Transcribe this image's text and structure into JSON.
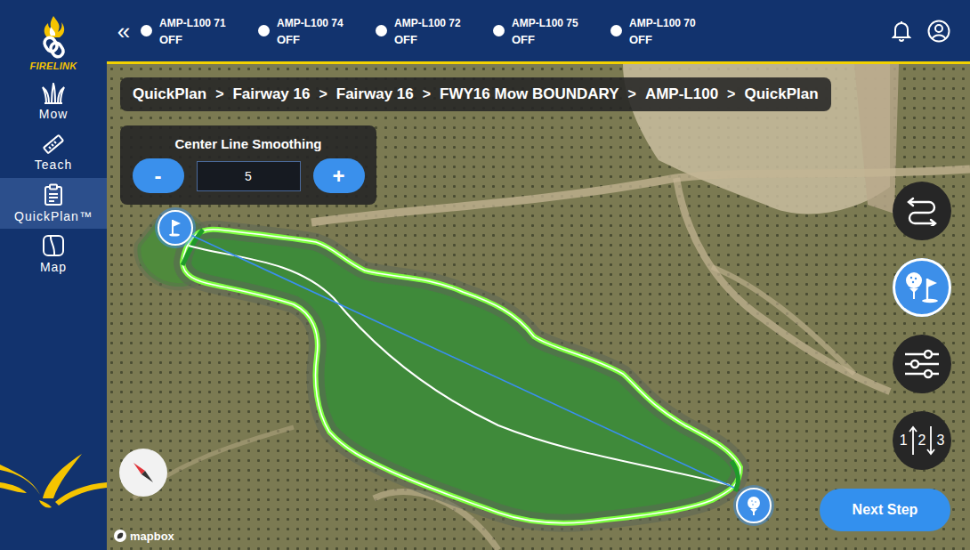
{
  "brand": {
    "name": "FIRELINK"
  },
  "sidebar": {
    "items": [
      {
        "label": "Mow",
        "selected": false,
        "kind": "mow"
      },
      {
        "label": "Teach",
        "selected": false,
        "kind": "teach"
      },
      {
        "label": "QuickPlan™",
        "selected": true,
        "kind": "plan"
      },
      {
        "label": "Map",
        "selected": false,
        "kind": "map"
      }
    ]
  },
  "topbar": {
    "collapse": "«",
    "devices": [
      {
        "name": "AMP-L100 71",
        "status": "OFF",
        "on": false
      },
      {
        "name": "AMP-L100 74",
        "status": "OFF",
        "on": false
      },
      {
        "name": "AMP-L100 72",
        "status": "OFF",
        "on": false
      },
      {
        "name": "AMP-L100 75",
        "status": "OFF",
        "on": false
      },
      {
        "name": "AMP-L100 70",
        "status": "OFF",
        "on": false
      }
    ]
  },
  "breadcrumb": {
    "separator": ">",
    "items": [
      "QuickPlan",
      "Fairway 16",
      "Fairway 16",
      "FWY16 Mow BOUNDARY",
      "AMP-L100",
      "QuickPlan"
    ]
  },
  "smoothing": {
    "label": "Center Line Smoothing",
    "value": "5",
    "decrement": "-",
    "increment": "+"
  },
  "tools": [
    {
      "kind": "route",
      "selected": false
    },
    {
      "kind": "teeflag",
      "selected": true
    },
    {
      "kind": "sliders",
      "selected": false
    },
    {
      "kind": "order",
      "selected": false,
      "labels": [
        "1",
        "2",
        "3"
      ]
    }
  ],
  "next_button": "Next Step",
  "map": {
    "attribution": "mapbox"
  }
}
